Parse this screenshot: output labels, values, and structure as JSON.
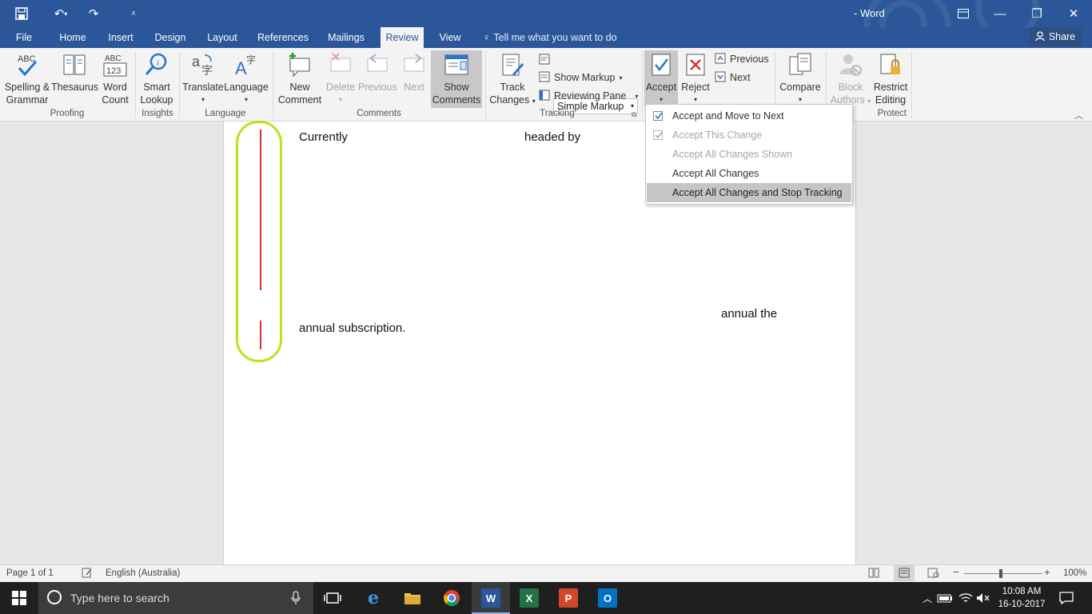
{
  "window": {
    "title": "- Word",
    "controls": {
      "minimize": "—",
      "restore": "❐",
      "close": "✕"
    }
  },
  "ribbon_tabs": [
    "File",
    "Home",
    "Insert",
    "Design",
    "Layout",
    "References",
    "Mailings",
    "Review",
    "View"
  ],
  "active_tab": "Review",
  "tell_me": "Tell me what you want to do",
  "share": "Share",
  "ribbon": {
    "proofing": {
      "label": "Proofing",
      "spelling_l1": "Spelling &",
      "spelling_l2": "Grammar",
      "thesaurus": "Thesaurus",
      "wordcount_l1": "Word",
      "wordcount_l2": "Count"
    },
    "insights": {
      "label": "Insights",
      "smart_l1": "Smart",
      "smart_l2": "Lookup"
    },
    "language": {
      "label": "Language",
      "translate": "Translate",
      "language": "Language"
    },
    "comments": {
      "label": "Comments",
      "new_l1": "New",
      "new_l2": "Comment",
      "delete": "Delete",
      "previous": "Previous",
      "next": "Next",
      "show_l1": "Show",
      "show_l2": "Comments"
    },
    "tracking": {
      "label": "Tracking",
      "track_l1": "Track",
      "track_l2": "Changes",
      "markup_select": "Simple Markup",
      "show_markup": "Show Markup",
      "reviewing_pane": "Reviewing Pane"
    },
    "changes": {
      "accept": "Accept",
      "reject": "Reject",
      "previous": "Previous",
      "next": "Next"
    },
    "compare": {
      "compare": "Compare"
    },
    "protect": {
      "label": "Protect",
      "block_l1": "Block",
      "block_l2": "Authors",
      "restrict_l1": "Restrict",
      "restrict_l2": "Editing"
    }
  },
  "accept_menu": [
    {
      "label": "Accept and Move to Next",
      "disabled": false
    },
    {
      "label": "Accept This Change",
      "disabled": true
    },
    {
      "label": "Accept All Changes Shown",
      "disabled": true
    },
    {
      "label": "Accept All Changes",
      "disabled": false
    },
    {
      "label": "Accept All Changes and Stop Tracking",
      "disabled": false
    }
  ],
  "document": {
    "line1_a": "Currently",
    "line1_b": "headed by",
    "line2_a": "annual the",
    "line3": "annual subscription."
  },
  "status": {
    "page": "Page 1 of 1",
    "language": "English (Australia)",
    "zoom": "100%"
  },
  "taskbar": {
    "search_placeholder": "Type here to search",
    "time": "10:08 AM",
    "date": "16-10-2017"
  },
  "colors": {
    "word_blue": "#2b579a",
    "highlight_green": "#b5e61d",
    "revision_red": "#d92b2b"
  }
}
